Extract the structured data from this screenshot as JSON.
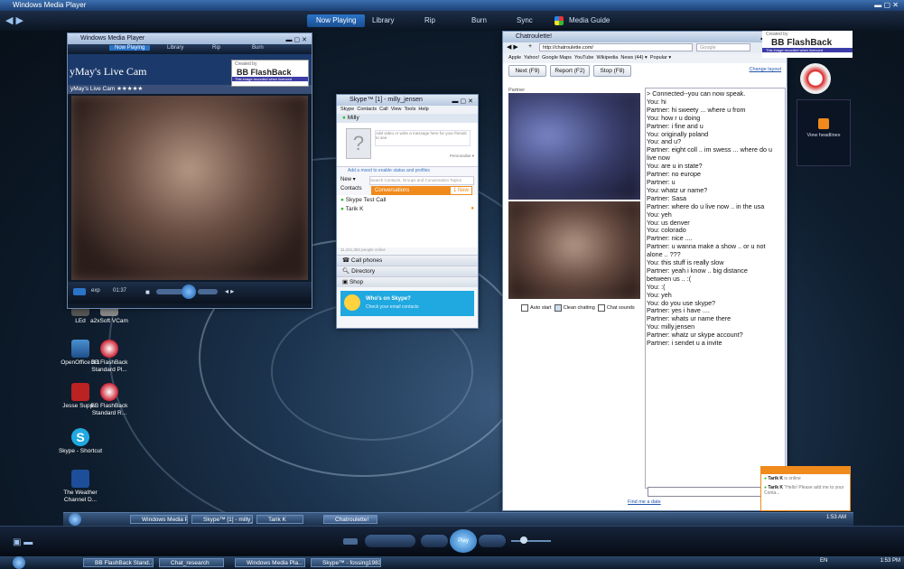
{
  "outer_window": {
    "title": "Windows Media Player",
    "nav_tabs": [
      "Now Playing",
      "Library",
      "Rip",
      "Burn",
      "Sync",
      "Media Guide"
    ],
    "window_controls": "▬ ▢ ✕"
  },
  "small_wmp": {
    "title": "Windows Media Player",
    "nav_tabs": [
      "Now Playing",
      "Library",
      "Rip",
      "Burn"
    ],
    "site_title": "yMay's Live Cam",
    "stream_label": "yMay's Live Cam ★★★★★",
    "time": "01:37",
    "status": "exp"
  },
  "flashback_banner": {
    "created_by": "Created by",
    "product": "BB FlashBack",
    "tagline": "This image recorded when licenced"
  },
  "skype": {
    "title": "Skype™ [1] - milly_jensen",
    "menu": [
      "Skype",
      "Contacts",
      "Call",
      "View",
      "Tools",
      "Help"
    ],
    "user": "Milly",
    "mood_placeholder": "Add video or write a message here for your friends to see",
    "personalise": "Personalise ▾",
    "status_link": "Add a mood to enable status and profiles",
    "new_button": "New ▾",
    "search_placeholder": "Search Contacts, Groups and Conversation Topics",
    "tabs": [
      "Contacts",
      "Conversations"
    ],
    "conversations_badge": "1 New",
    "contacts": [
      "Skype Test Call",
      "Tarik K"
    ],
    "online_count": "11,411,353 people online",
    "sections": [
      "Call phones",
      "Directory",
      "Shop"
    ],
    "promo_title": "Who's on Skype?",
    "promo_sub": "Check your email contacts"
  },
  "browser": {
    "title": "Chatroulette!",
    "url": "http://chatroulette.com/",
    "search_placeholder": "Google",
    "bookmarks": [
      "Apple",
      "Yahoo!",
      "Google Maps",
      "YouTube",
      "Wikipedia",
      "News (44) ▾",
      "Popular ▾"
    ],
    "buttons": [
      "Next (F9)",
      "Report (F2)",
      "Stop (F8)"
    ],
    "change_layout": "Change layout",
    "partner_label": "Partner",
    "checkboxes": [
      "Auto start",
      "Clean chatting",
      "Chat sounds"
    ],
    "find_date": "Find me a date",
    "chat_lines": [
      "> Connected--you can now speak.",
      "You: hi",
      "Partner: hi sweety ... where u from",
      "You: how r u doing",
      "Partner: i fine and u",
      "You: originally poland",
      "You: and u?",
      "Partner: eight coll .. im swess ... where do u live now",
      "You: are u in state?",
      "Partner: no europe",
      "Partner: u",
      "You: whatz ur name?",
      "Partner: Sasa",
      "Partner: where do u live now .. in the usa",
      "You: yeh",
      "You: us denver",
      "You: colorado",
      "Partner: nice ....",
      "Partner: u wanna make a show .. or u not alone .. ???",
      "You: this stuff is really slow",
      "Partner: yeah i know .. big distance between us .. :(",
      "You: :(",
      "You: yeh",
      "You: do you use skype?",
      "Partner: yes i have ....",
      "Partner: whats ur name there",
      "You: milly.jensen",
      "Partner: whatz ur skype account?",
      "Partner: i sendet u a invite"
    ]
  },
  "gadget": {
    "label": "View headlines"
  },
  "desktop_icons": [
    {
      "label": "LEd"
    },
    {
      "label": "a2xSoft VCam"
    },
    {
      "label": "OpenOffice 3.1"
    },
    {
      "label": "BB FlashBack Standard Pl..."
    },
    {
      "label": "Jesse Supp..."
    },
    {
      "label": "BB FlashBack Standard R..."
    },
    {
      "label": "Skype - Shortcut"
    },
    {
      "label": "The Weather Channel D..."
    }
  ],
  "inner_taskbar": {
    "buttons": [
      "Windows Media Pla...",
      "Skype™ [1] - milly_je...",
      "Tarik K",
      "Chatroulette!"
    ],
    "clock": "1:53 AM"
  },
  "toast": {
    "rows": [
      {
        "name": "Tarik K",
        "text": "is online"
      },
      {
        "name": "Tarik K",
        "text": "\"Hello! Please add me to your Conta..."
      }
    ]
  },
  "player_controls": {
    "play_label": "Play"
  },
  "outer_taskbar": {
    "buttons": [
      "BB FlashBack Stand...",
      "Chat_research",
      "Windows Media Pla...",
      "Skype™ - fossing1983"
    ],
    "lang": "EN",
    "clock": "1:53 PM"
  },
  "colors": {
    "accent_orange": "#f08a1c",
    "skype_blue": "#20a8e0",
    "wmp_blue": "#2b74c8"
  }
}
